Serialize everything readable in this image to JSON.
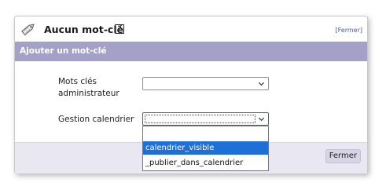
{
  "header": {
    "title": "Aucun mot-clé",
    "help_glyph": "?",
    "close_link": "[Fermer]",
    "icon": "tag-icon"
  },
  "section": {
    "title": "Ajouter un mot-clé"
  },
  "form": {
    "admin_keywords_label": "Mots clés administrateur",
    "admin_keywords_value": "",
    "calendar_label": "Gestion calendrier",
    "calendar_value": ""
  },
  "dropdown": {
    "options": [
      "",
      "calendrier_visible",
      "_publier_dans_calendrier"
    ],
    "highlighted_index": 1
  },
  "footer": {
    "close_button": "Fermer"
  },
  "colors": {
    "section_bar": "#a4a1c8",
    "footer_bg": "#e9e8f2",
    "highlight": "#1e6fd6"
  }
}
